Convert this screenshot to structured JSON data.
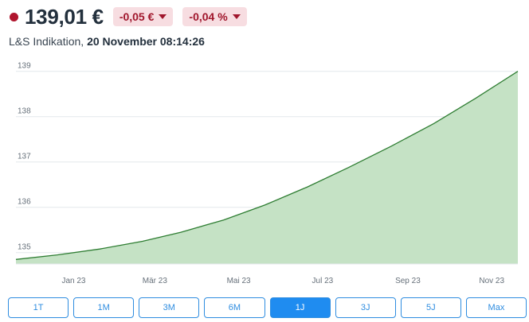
{
  "quote": {
    "price": "139,01 €",
    "change_abs": "-0,05 €",
    "change_pct": "-0,04 %",
    "source": "L&S Indikation,",
    "timestamp": "20 November 08:14:26"
  },
  "periods": [
    {
      "label": "1T",
      "active": false
    },
    {
      "label": "1M",
      "active": false
    },
    {
      "label": "3M",
      "active": false
    },
    {
      "label": "6M",
      "active": false
    },
    {
      "label": "1J",
      "active": true
    },
    {
      "label": "3J",
      "active": false
    },
    {
      "label": "5J",
      "active": false
    },
    {
      "label": "Max",
      "active": false
    }
  ],
  "colors": {
    "down": "#a0162c",
    "line": "#2e7d32",
    "area": "#c5e2c5",
    "accent": "#1f8cf0"
  },
  "chart_data": {
    "type": "area",
    "y_ticks": [
      "139",
      "138",
      "137",
      "136",
      "135"
    ],
    "x_ticks": [
      "Jan 23",
      "Mär 23",
      "Mai 23",
      "Jul 23",
      "Sep 23",
      "Nov 23"
    ],
    "ylim": [
      134.75,
      139.1
    ],
    "grid": true,
    "series": [
      {
        "x": [
          "2022-11-20",
          "2022-12-20",
          "2023-01-20",
          "2023-02-20",
          "2023-03-20",
          "2023-04-20",
          "2023-05-20",
          "2023-06-20",
          "2023-07-20",
          "2023-08-20",
          "2023-09-20",
          "2023-10-20",
          "2023-11-20"
        ],
        "values": [
          134.85,
          134.95,
          135.08,
          135.25,
          135.45,
          135.72,
          136.05,
          136.45,
          136.88,
          137.35,
          137.85,
          138.4,
          139.0
        ]
      }
    ]
  }
}
